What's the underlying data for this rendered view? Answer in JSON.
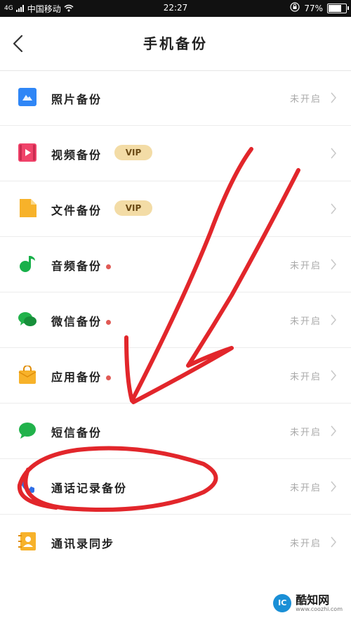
{
  "status_bar": {
    "signal": "4G",
    "carrier": "中国移动",
    "time": "22:27",
    "battery": "77%",
    "battery_level": 0.77
  },
  "header": {
    "title": "手机备份",
    "back_icon": "chevron-left-icon"
  },
  "items": [
    {
      "label": "照片备份",
      "status": "未开启",
      "icon": "photo-icon",
      "icon_color": "#2f86f6"
    },
    {
      "label": "视频备份",
      "badge": "VIP",
      "icon": "video-icon",
      "icon_color": "#f0436a"
    },
    {
      "label": "文件备份",
      "badge": "VIP",
      "icon": "file-icon",
      "icon_color": "#f7b22a"
    },
    {
      "label": "音频备份",
      "status": "未开启",
      "dot": true,
      "icon": "music-icon",
      "icon_color": "#18b04a"
    },
    {
      "label": "微信备份",
      "status": "未开启",
      "dot": true,
      "icon": "wechat-icon",
      "icon_color": "#21b24b"
    },
    {
      "label": "应用备份",
      "status": "未开启",
      "dot": true,
      "icon": "app-bag-icon",
      "icon_color": "#f7b22a"
    },
    {
      "label": "短信备份",
      "status": "未开启",
      "icon": "sms-icon",
      "icon_color": "#21b24b"
    },
    {
      "label": "通话记录备份",
      "status": "未开启",
      "icon": "phone-icon",
      "icon_color": "#2f6ee6"
    },
    {
      "label": "通讯录同步",
      "status": "未开启",
      "icon": "contacts-icon",
      "icon_color": "#f7b22a"
    }
  ],
  "watermark": {
    "name": "酷知网",
    "url": "www.coozhi.com",
    "logo_text": "IC"
  },
  "colors": {
    "status_off": "#a9a9a9",
    "dot": "#e05a55",
    "vip_bg": "#f3dca6",
    "annotation": "#e2262b"
  }
}
